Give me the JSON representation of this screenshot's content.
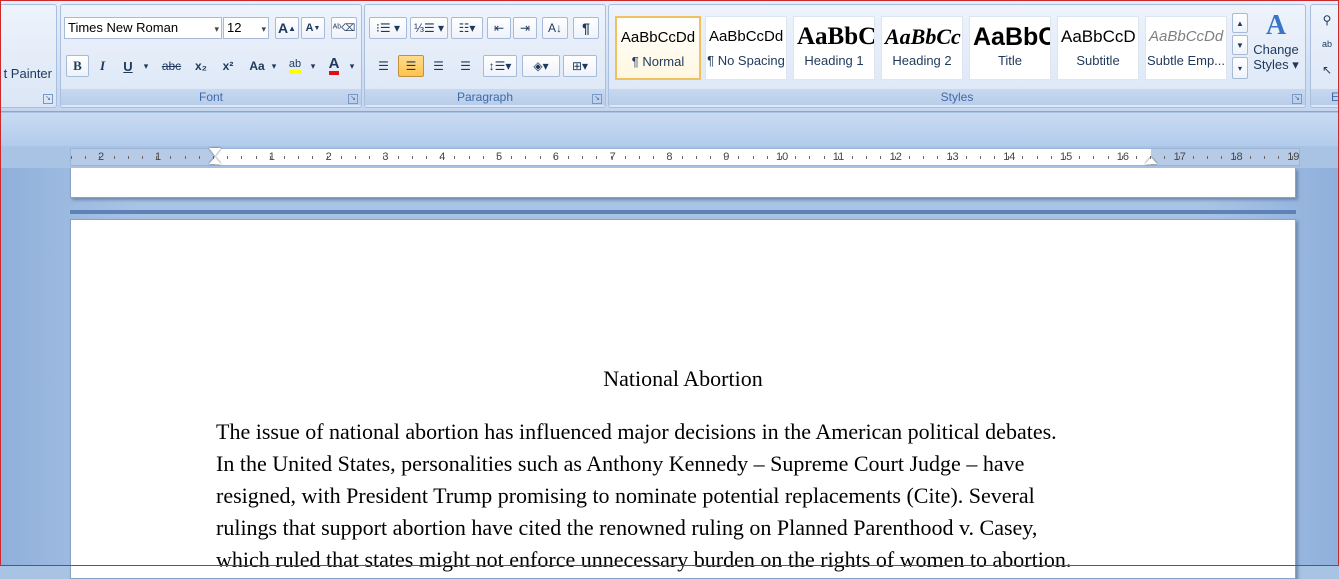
{
  "ribbon": {
    "clipboard": {
      "format_painter_label": "t Painter"
    },
    "font": {
      "group_label": "Font",
      "font_name": "Times New Roman",
      "font_size": "12",
      "bold": "B",
      "italic": "I",
      "underline": "U",
      "strikethrough": "abc",
      "subscript": "x₂",
      "superscript": "x²",
      "change_case": "Aa",
      "grow_font": "A",
      "shrink_font": "A"
    },
    "paragraph": {
      "group_label": "Paragraph",
      "show_marks": "¶"
    },
    "styles": {
      "group_label": "Styles",
      "items": [
        {
          "sample": "AaBbCcDd",
          "name": "¶ Normal"
        },
        {
          "sample": "AaBbCcDd",
          "name": "¶ No Spacing"
        },
        {
          "sample": "AaBbC",
          "name": "Heading 1"
        },
        {
          "sample": "AaBbCc",
          "name": "Heading 2"
        },
        {
          "sample": "AaBbC",
          "name": "Title"
        },
        {
          "sample": "AaBbCcD",
          "name": "Subtitle"
        },
        {
          "sample": "AaBbCcDd",
          "name": "Subtle Emp..."
        }
      ],
      "change_styles_line1": "Change",
      "change_styles_line2": "Styles"
    },
    "editing": {
      "group_label": "E"
    }
  },
  "ruler": {
    "left_numbers": [
      "2",
      "1"
    ],
    "right_numbers": [
      "1",
      "2",
      "3",
      "4",
      "5",
      "6",
      "7",
      "8",
      "9",
      "10",
      "11",
      "12",
      "13",
      "14",
      "15",
      "16",
      "17",
      "18",
      "19"
    ]
  },
  "document": {
    "title": "National Abortion",
    "lines": [
      "The issue of national abortion has influenced major decisions in the American political debates.",
      "In the United States, personalities such as Anthony Kennedy – Supreme Court Judge – have",
      "resigned, with President Trump promising to nominate potential replacements (Cite). Several",
      "rulings that support abortion have cited the renowned ruling on Planned Parenthood v. Casey,",
      "which ruled that states might not enforce unnecessary burden on the rights of women to abortion."
    ]
  }
}
